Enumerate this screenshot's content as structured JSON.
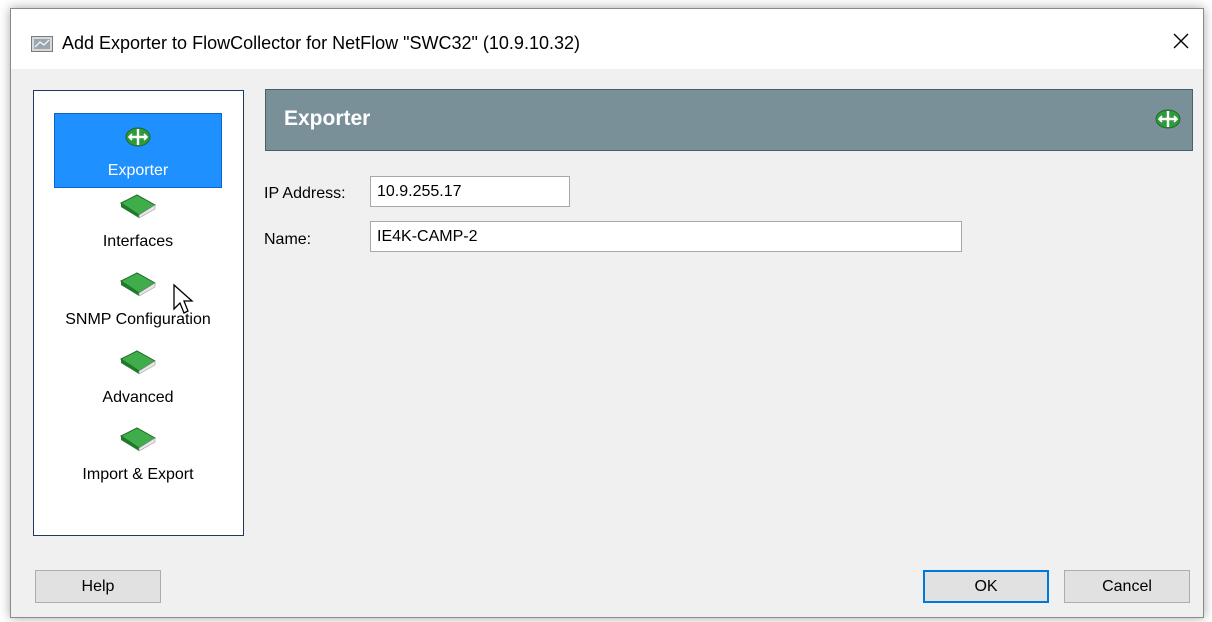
{
  "window": {
    "title": "Add Exporter to FlowCollector for NetFlow \"SWC32\" (10.9.10.32)",
    "close_glyph": "✕"
  },
  "nav": {
    "items": [
      {
        "label": "Exporter",
        "icon": "exporter-icon",
        "selected": true
      },
      {
        "label": "Interfaces",
        "icon": "book-icon",
        "selected": false
      },
      {
        "label": "SNMP Configuration",
        "icon": "book-icon",
        "selected": false
      },
      {
        "label": "Advanced",
        "icon": "book-icon",
        "selected": false
      },
      {
        "label": "Import & Export",
        "icon": "book-icon",
        "selected": false
      }
    ]
  },
  "header": {
    "title": "Exporter",
    "icon": "exporter-icon"
  },
  "form": {
    "ip_label": "IP Address:",
    "ip_value": "10.9.255.17",
    "name_label": "Name:",
    "name_value": "IE4K-CAMP-2"
  },
  "buttons": {
    "help": "Help",
    "ok": "OK",
    "cancel": "Cancel"
  },
  "colors": {
    "selection": "#1e90ff",
    "banner": "#7a9098",
    "icon_green": "#2e9a3c",
    "default_button_border": "#0078d7"
  }
}
